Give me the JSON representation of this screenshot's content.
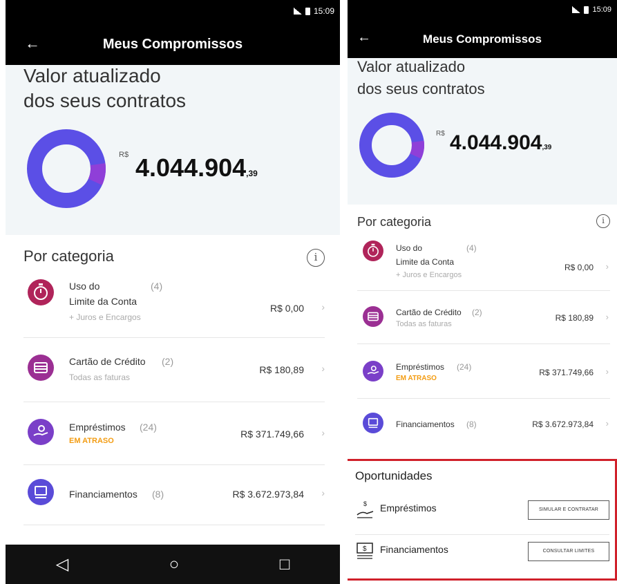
{
  "statusbar": {
    "time": "15:09"
  },
  "appbar": {
    "back": "←",
    "title": "Meus Compromissos"
  },
  "summary": {
    "title_line1": "Valor atualizado",
    "title_line2": "dos seus contratos",
    "currency": "R$",
    "amount_integer": "4.044.904",
    "amount_cents": ",39"
  },
  "category_section": {
    "title": "Por categoria",
    "info_icon": "info-icon"
  },
  "categories": [
    {
      "name": "Uso do",
      "name2": "Limite da Conta",
      "count": "(4)",
      "subtitle": "+ Juros e Encargos",
      "value": "R$ 0,00",
      "icon": "timer-icon",
      "color": "#b0245a"
    },
    {
      "name": "Cartão de Crédito",
      "count": "(2)",
      "subtitle": "Todas as faturas",
      "value": "R$ 180,89",
      "icon": "credit-card-icon",
      "color": "#9b2f93"
    },
    {
      "name": "Empréstimos",
      "count": "(24)",
      "subtitle": "EM ATRASO",
      "value": "R$ 371.749,66",
      "icon": "money-hand-icon",
      "color": "#7a3fc8"
    },
    {
      "name": "Financiamentos",
      "count": "(8)",
      "subtitle": "",
      "value": "R$ 3.672.973,84",
      "icon": "financing-icon",
      "color": "#5a4bd8"
    }
  ],
  "navbar": {
    "back": "◁",
    "home": "○",
    "recents": "□"
  },
  "opportunities": {
    "title": "Oportunidades",
    "items": [
      {
        "name": "Empréstimos",
        "button": "SIMULAR E CONTRATAR",
        "icon": "money-hand-outline-icon"
      },
      {
        "name": "Financiamentos",
        "button": "CONSULTAR LIMITES",
        "icon": "banknote-outline-icon"
      }
    ]
  },
  "colors": {
    "donut_main": "#5b4fe6",
    "donut_accent": "#8f3fd8",
    "late": "#f39c12",
    "highlight_border": "#d0202a"
  },
  "chart_data": {
    "type": "pie",
    "title": "",
    "categories": [
      "Uso do Limite da Conta",
      "Cartão de Crédito",
      "Empréstimos",
      "Financiamentos"
    ],
    "values": [
      0.0,
      180.89,
      371749.66,
      3672973.84
    ]
  }
}
